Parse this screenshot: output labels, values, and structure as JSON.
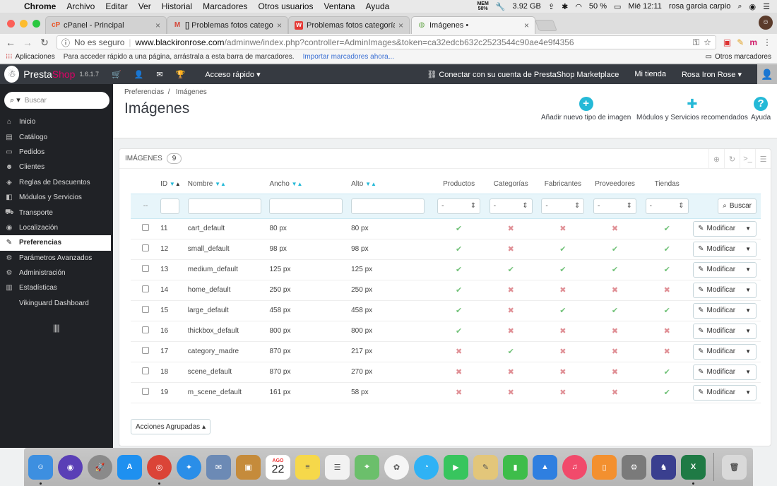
{
  "menubar": {
    "app": "Chrome",
    "items": [
      "Archivo",
      "Editar",
      "Ver",
      "Historial",
      "Marcadores",
      "Otros usuarios",
      "Ventana",
      "Ayuda"
    ],
    "mem_top": "MEM",
    "mem_bottom": "50%",
    "memory": "3.92 GB",
    "battery": "50 %",
    "clock": "Mié 12:11",
    "user": "rosa garcia carpio"
  },
  "tabs": [
    {
      "icon": "cP",
      "label": "cPanel - Principal",
      "color": "#e8572a"
    },
    {
      "icon": "M",
      "label": "[] Problemas fotos categorías si",
      "color": "#d44638"
    },
    {
      "icon": "w",
      "label": "Problemas fotos categorías si",
      "color": "#e53935"
    },
    {
      "icon": "◍",
      "label": "Imágenes •",
      "color": "#6aa84f"
    }
  ],
  "address": {
    "insecure": "No es seguro",
    "domain": "www.blackironrose.com",
    "path": "/adminwe/index.php?controller=AdminImages&token=ca32edcb632c2523544c90ae4e9f4356"
  },
  "bookmarks": {
    "apps": "Aplicaciones",
    "hint": "Para acceder rápido a una página, arrástrala a esta barra de marcadores.",
    "import": "Importar marcadores ahora...",
    "other": "Otros marcadores"
  },
  "ps_header": {
    "brand_a": "Presta",
    "brand_b": "Shop",
    "version": "1.6.1.7",
    "quick_access": "Acceso rápido ▾",
    "marketplace": "Conectar con su cuenta de PrestaShop Marketplace",
    "my_shop": "Mi tienda",
    "user": "Rosa Iron Rose ▾"
  },
  "sidebar": {
    "search_placeholder": "Buscar",
    "items": [
      {
        "icon": "⌂",
        "label": "Inicio"
      },
      {
        "icon": "▤",
        "label": "Catálogo"
      },
      {
        "icon": "▭",
        "label": "Pedidos"
      },
      {
        "icon": "☻",
        "label": "Clientes"
      },
      {
        "icon": "◈",
        "label": "Reglas de Descuentos"
      },
      {
        "icon": "◧",
        "label": "Módulos y Servicios"
      },
      {
        "icon": "⛟",
        "label": "Transporte"
      },
      {
        "icon": "◉",
        "label": "Localización"
      },
      {
        "icon": "✎",
        "label": "Preferencias"
      },
      {
        "icon": "⚙",
        "label": "Parámetros Avanzados"
      },
      {
        "icon": "⚙",
        "label": "Administración"
      },
      {
        "icon": "▥",
        "label": "Estadísticas"
      },
      {
        "icon": "",
        "label": "Vikinguard Dashboard"
      }
    ],
    "active_index": 8
  },
  "page": {
    "breadcrumb_parent": "Preferencias",
    "breadcrumb_current": "Imágenes",
    "title": "Imágenes",
    "actions": {
      "add": "Añadir nuevo tipo de imagen",
      "modules": "Módulos y Servicios recomendados",
      "help": "Ayuda"
    }
  },
  "panel": {
    "title": "Imágenes",
    "count": "9",
    "columns": {
      "id": "ID",
      "name": "Nombre",
      "width": "Ancho",
      "height": "Alto",
      "products": "Productos",
      "categories": "Categorías",
      "manufacturers": "Fabricantes",
      "suppliers": "Proveedores",
      "stores": "Tiendas"
    },
    "filter_dash": "--",
    "select_default": "-",
    "search_btn": "Buscar",
    "edit_label": "Modificar",
    "bulk_label": "Acciones Agrupadas",
    "rows": [
      {
        "id": "11",
        "name": "cart_default",
        "width": "80 px",
        "height": "80 px",
        "flags": [
          true,
          false,
          false,
          false,
          true
        ]
      },
      {
        "id": "12",
        "name": "small_default",
        "width": "98 px",
        "height": "98 px",
        "flags": [
          true,
          false,
          true,
          true,
          true
        ]
      },
      {
        "id": "13",
        "name": "medium_default",
        "width": "125 px",
        "height": "125 px",
        "flags": [
          true,
          true,
          true,
          true,
          true
        ]
      },
      {
        "id": "14",
        "name": "home_default",
        "width": "250 px",
        "height": "250 px",
        "flags": [
          true,
          false,
          false,
          false,
          false
        ]
      },
      {
        "id": "15",
        "name": "large_default",
        "width": "458 px",
        "height": "458 px",
        "flags": [
          true,
          false,
          true,
          true,
          true
        ]
      },
      {
        "id": "16",
        "name": "thickbox_default",
        "width": "800 px",
        "height": "800 px",
        "flags": [
          true,
          false,
          false,
          false,
          false
        ]
      },
      {
        "id": "17",
        "name": "category_madre",
        "width": "870 px",
        "height": "217 px",
        "flags": [
          false,
          true,
          false,
          false,
          false
        ]
      },
      {
        "id": "18",
        "name": "scene_default",
        "width": "870 px",
        "height": "270 px",
        "flags": [
          false,
          false,
          false,
          false,
          true
        ]
      },
      {
        "id": "19",
        "name": "m_scene_default",
        "width": "161 px",
        "height": "58 px",
        "flags": [
          false,
          false,
          false,
          false,
          true
        ]
      }
    ]
  },
  "colors": {
    "check": "#72c279",
    "cross": "#e08f95",
    "accent": "#25b9d7",
    "header_bg": "#363a41",
    "sidebar_bg": "#202226"
  },
  "dock": {
    "calendar_month": "AGO",
    "calendar_day": "22",
    "apps": [
      {
        "name": "finder-icon",
        "bg": "#3d8fe0",
        "glyph": "☺",
        "running": true
      },
      {
        "name": "siri-icon",
        "bg": "#5a3fb6",
        "glyph": "◉",
        "running": false,
        "round": true
      },
      {
        "name": "launchpad-icon",
        "bg": "#8a8a8a",
        "glyph": "🚀",
        "running": false,
        "round": true
      },
      {
        "name": "app-store-icon",
        "bg": "#1e90f0",
        "glyph": "A",
        "running": false
      },
      {
        "name": "chrome-icon",
        "bg": "#db4437",
        "glyph": "◎",
        "running": true,
        "round": true
      },
      {
        "name": "safari-icon",
        "bg": "#2a8ee8",
        "glyph": "✦",
        "running": false,
        "round": true
      },
      {
        "name": "mail-icon",
        "bg": "#6c8ab5",
        "glyph": "✉",
        "running": false
      },
      {
        "name": "notes-book-icon",
        "bg": "#c58b3b",
        "glyph": "▣",
        "running": false
      },
      {
        "name": "calendar-icon",
        "bg": "#ffffff",
        "glyph": "",
        "running": false,
        "calendar": true
      },
      {
        "name": "notes-icon",
        "bg": "#f6d84a",
        "glyph": "≡",
        "running": false
      },
      {
        "name": "reminders-icon",
        "bg": "#f2f2f2",
        "glyph": "☰",
        "running": false
      },
      {
        "name": "maps-icon",
        "bg": "#6bbf6b",
        "glyph": "⌖",
        "running": false
      },
      {
        "name": "photos-icon",
        "bg": "#f5f5f5",
        "glyph": "✿",
        "running": false,
        "round": true
      },
      {
        "name": "messages-icon",
        "bg": "#2fb2f5",
        "glyph": "◔",
        "running": false,
        "round": true
      },
      {
        "name": "facetime-icon",
        "bg": "#38c55e",
        "glyph": "▶",
        "running": false
      },
      {
        "name": "keynote-icon",
        "bg": "#e3c67a",
        "glyph": "✎",
        "running": false
      },
      {
        "name": "numbers-icon",
        "bg": "#3ebd4a",
        "glyph": "▮",
        "running": false
      },
      {
        "name": "presentation-icon",
        "bg": "#2f7fe0",
        "glyph": "▲",
        "running": false
      },
      {
        "name": "music-icon",
        "bg": "#f14a6b",
        "glyph": "♫",
        "running": false,
        "round": true
      },
      {
        "name": "books-icon",
        "bg": "#f3902f",
        "glyph": "▯",
        "running": false
      },
      {
        "name": "system-preferences-icon",
        "bg": "#7a7a7a",
        "glyph": "⚙",
        "running": false
      },
      {
        "name": "inkscape-icon",
        "bg": "#3a3f8f",
        "glyph": "♞",
        "running": false
      },
      {
        "name": "excel-icon",
        "bg": "#1f7a45",
        "glyph": "X",
        "running": true
      },
      {
        "name": "trash-icon",
        "bg": "#d9d9d9",
        "glyph": "🗑",
        "running": false,
        "trash": true
      }
    ]
  }
}
